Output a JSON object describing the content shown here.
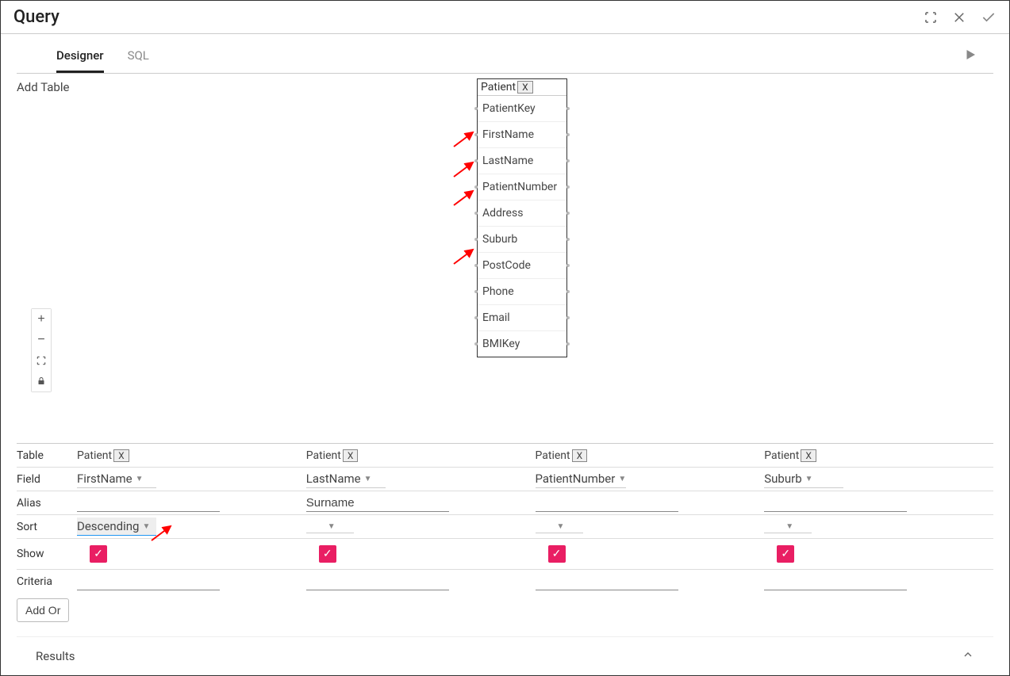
{
  "title": "Query",
  "tabs": {
    "designer": "Designer",
    "sql": "SQL"
  },
  "design": {
    "add_table": "Add Table",
    "entity": {
      "name": "Patient",
      "close": "X",
      "fields": [
        "PatientKey",
        "FirstName",
        "LastName",
        "PatientNumber",
        "Address",
        "Suburb",
        "PostCode",
        "Phone",
        "Email",
        "BMIKey"
      ]
    },
    "pointed_fields": [
      "FirstName",
      "LastName",
      "PatientNumber",
      "Suburb"
    ]
  },
  "grid": {
    "labels": {
      "table": "Table",
      "field": "Field",
      "alias": "Alias",
      "sort": "Sort",
      "show": "Show",
      "criteria": "Criteria",
      "addor": "Add Or"
    },
    "columns": [
      {
        "table": "Patient",
        "field": "FirstName",
        "alias": "",
        "sort": "Descending",
        "show": true,
        "criteria": ""
      },
      {
        "table": "Patient",
        "field": "LastName",
        "alias": "Surname",
        "sort": "",
        "show": true,
        "criteria": ""
      },
      {
        "table": "Patient",
        "field": "PatientNumber",
        "alias": "",
        "sort": "",
        "show": true,
        "criteria": ""
      },
      {
        "table": "Patient",
        "field": "Suburb",
        "alias": "",
        "sort": "",
        "show": true,
        "criteria": ""
      }
    ],
    "chip_close": "X"
  },
  "results": {
    "label": "Results"
  }
}
